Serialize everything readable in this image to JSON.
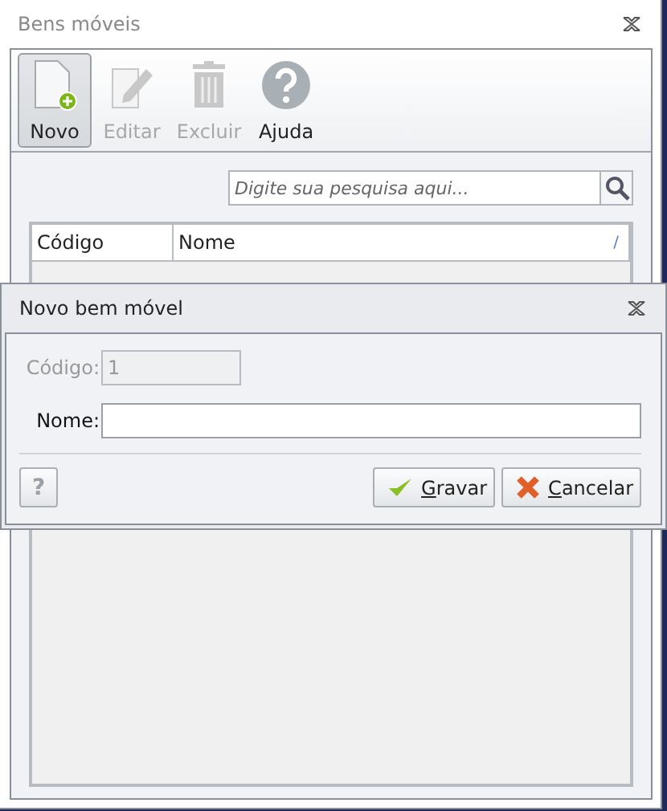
{
  "window": {
    "title": "Bens móveis"
  },
  "toolbar": [
    {
      "label": "Novo",
      "kind": "new",
      "selected": true,
      "disabled": false
    },
    {
      "label": "Editar",
      "kind": "edit",
      "selected": false,
      "disabled": true
    },
    {
      "label": "Excluir",
      "kind": "delete",
      "selected": false,
      "disabled": true
    },
    {
      "label": "Ajuda",
      "kind": "help",
      "selected": false,
      "disabled": false
    }
  ],
  "search": {
    "placeholder": "Digite sua pesquisa aqui..."
  },
  "table": {
    "columns": [
      {
        "label": "Código"
      },
      {
        "label": "Nome",
        "sort_mark": "/"
      }
    ]
  },
  "dialog": {
    "title": "Novo bem móvel",
    "fields": [
      {
        "label": "Código:",
        "value": "1",
        "disabled": true
      },
      {
        "label": "Nome:",
        "disabled": false
      }
    ],
    "help_button": "?",
    "buttons": [
      {
        "label": "Gravar",
        "kind": "save",
        "mnemonic_underlined": true
      },
      {
        "label": "Cancelar",
        "kind": "cancel",
        "mnemonic_underlined": true
      }
    ]
  }
}
